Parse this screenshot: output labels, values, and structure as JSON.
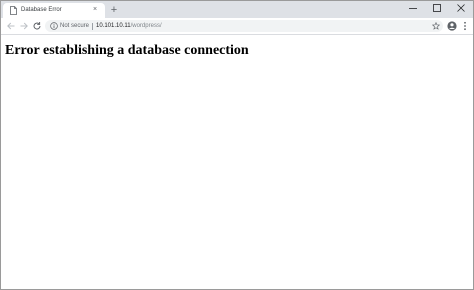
{
  "tab": {
    "title": "Database Error",
    "close_label": "×",
    "new_tab_label": "+"
  },
  "toolbar": {
    "security_label": "Not secure",
    "url_host": "10.101.10.11",
    "url_path": "/wordpress/"
  },
  "page": {
    "heading": "Error establishing a database connection"
  },
  "icons": {
    "favicon": "page-icon",
    "back": "arrow-left-icon",
    "forward": "arrow-right-icon",
    "reload": "reload-icon",
    "info": "info-icon",
    "bookmark": "star-icon",
    "profile": "account-circle-icon",
    "menu": "kebab-menu-icon",
    "minimize": "minimize-icon",
    "maximize": "maximize-icon",
    "close_window": "close-icon"
  },
  "colors": {
    "tabstrip_bg": "#dee1e6",
    "omnibox_bg": "#f1f3f4",
    "icon": "#5f6368",
    "url_path": "#80868b"
  }
}
